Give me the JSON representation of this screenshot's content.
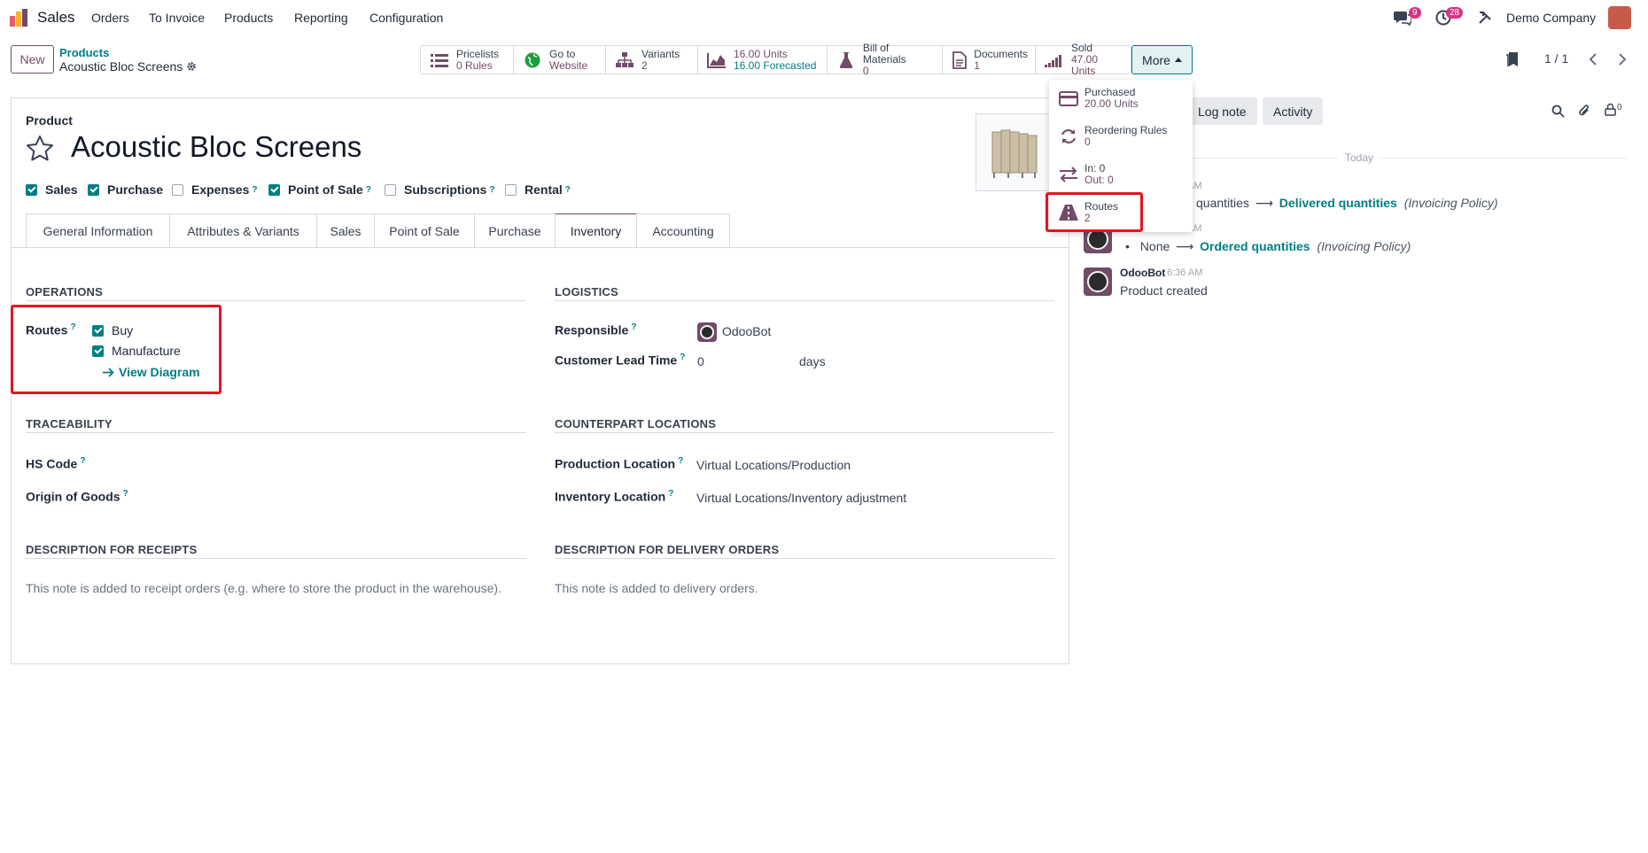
{
  "topnav": {
    "app": "Sales",
    "menus": [
      "Orders",
      "To Invoice",
      "Products",
      "Reporting",
      "Configuration"
    ],
    "messages_badge": "9",
    "activities_badge": "28",
    "company": "Demo Company"
  },
  "control": {
    "new_label": "New",
    "breadcrumb_parent": "Products",
    "breadcrumb_current": "Acoustic Bloc Screens",
    "pager": "1 / 1",
    "more_label": "More"
  },
  "stats": [
    {
      "icon": "list-icon",
      "line1": "Pricelists",
      "line2": "0 Rules"
    },
    {
      "icon": "globe-icon",
      "line1": "Go to",
      "line2": "Website"
    },
    {
      "icon": "sitemap-icon",
      "line1": "Variants",
      "line2": "2"
    },
    {
      "icon": "area-chart-icon",
      "line1": "16.00 Units",
      "line2": "16.00 Forecasted"
    },
    {
      "icon": "flask-icon",
      "line1": "Bill of Materials",
      "line2": "0"
    },
    {
      "icon": "file-icon",
      "line1": "Documents",
      "line2": "1"
    },
    {
      "icon": "signal-icon",
      "line1": "Sold",
      "line2": "47.00 Units"
    }
  ],
  "more_menu": [
    {
      "icon": "credit-card-icon",
      "line1": "Purchased",
      "line2": "20.00 Units"
    },
    {
      "icon": "refresh-icon",
      "line1": "Reordering Rules",
      "line2": "0"
    },
    {
      "icon": "exchange-icon",
      "line1": "In: 0",
      "line2": "Out: 0"
    },
    {
      "icon": "road-icon",
      "line1": "Routes",
      "line2": "2"
    }
  ],
  "product": {
    "sheet_label": "Product",
    "name": "Acoustic Bloc Screens",
    "flags": [
      {
        "label": "Sales",
        "checked": true
      },
      {
        "label": "Purchase",
        "checked": true
      },
      {
        "label": "Expenses",
        "checked": false
      },
      {
        "label": "Point of Sale",
        "checked": true
      },
      {
        "label": "Subscriptions",
        "checked": false
      },
      {
        "label": "Rental",
        "checked": false
      }
    ],
    "help_mark": "?"
  },
  "tabs": [
    "General Information",
    "Attributes & Variants",
    "Sales",
    "Point of Sale",
    "Purchase",
    "Inventory",
    "Accounting"
  ],
  "inventory": {
    "operations_title": "OPERATIONS",
    "routes_label": "Routes",
    "routes": [
      "Buy",
      "Manufacture"
    ],
    "view_diagram": "View Diagram",
    "logistics_title": "LOGISTICS",
    "responsible_label": "Responsible",
    "responsible_value": "OdooBot",
    "lead_time_label": "Customer Lead Time",
    "lead_time_value": "0",
    "lead_time_unit": "days",
    "traceability_title": "TRACEABILITY",
    "hs_code_label": "HS Code",
    "origin_label": "Origin of Goods",
    "counterpart_title": "COUNTERPART LOCATIONS",
    "production_label": "Production Location",
    "production_value": "Virtual Locations/Production",
    "inventory_loc_label": "Inventory Location",
    "inventory_loc_value": "Virtual Locations/Inventory adjustment",
    "receipts_title": "DESCRIPTION FOR RECEIPTS",
    "receipts_placeholder": "This note is added to receipt orders (e.g. where to store the product in the warehouse).",
    "delivery_title": "DESCRIPTION FOR DELIVERY ORDERS",
    "delivery_placeholder": "This note is added to delivery orders."
  },
  "chatter": {
    "log_note": "Log note",
    "activity": "Activity",
    "followers": "0",
    "today": "Today",
    "m1_time": "AM",
    "m1_old": "quantities",
    "m1_new": "Delivered quantities",
    "m1_field": "(Invoicing Policy)",
    "m2_time": "AM",
    "m2_old": "None",
    "m2_new": "Ordered quantities",
    "m2_field": "(Invoicing Policy)",
    "m3_author": "OdooBot",
    "m3_time": "6:36 AM",
    "m3_body": "Product created"
  },
  "colors": {
    "brand": "#714b67",
    "teal": "#017e84",
    "highlight": "#e5131d"
  }
}
